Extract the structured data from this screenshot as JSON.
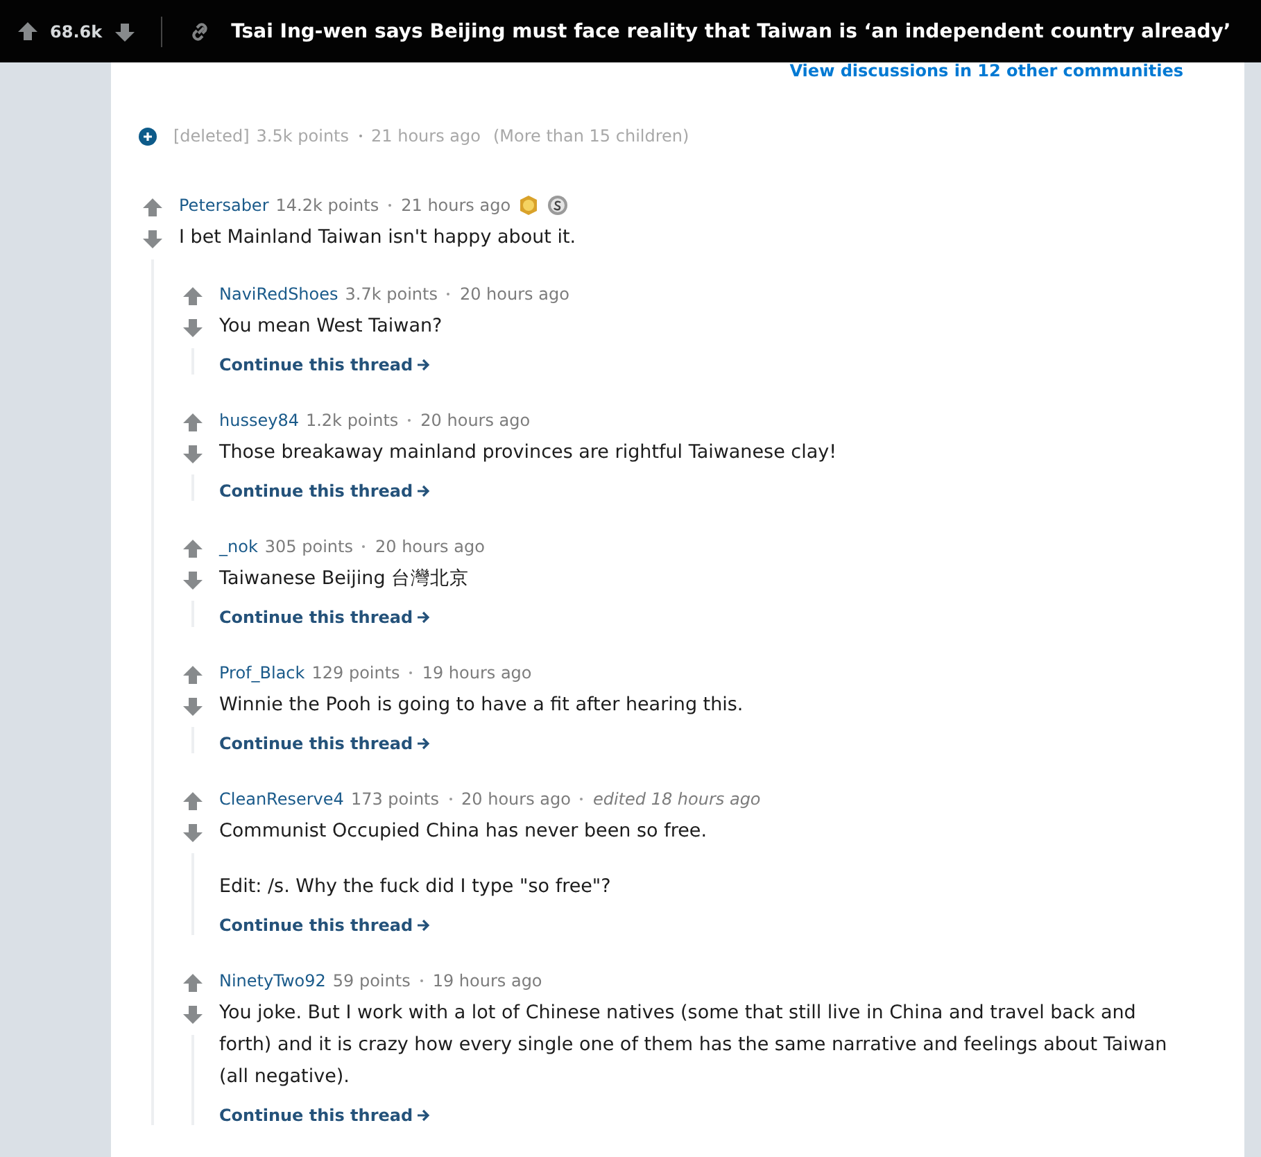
{
  "header": {
    "score": "68.6k",
    "title": "Tsai Ing-wen says Beijing must face reality that Taiwan is ‘an independent country already’"
  },
  "other_discussions": "View discussions in 12 other communities",
  "collapsed_comment": {
    "author": "[deleted]",
    "points": "3.5k points",
    "time": "21 hours ago",
    "children_note": "(More than 15 children)"
  },
  "comment": {
    "author": "Petersaber",
    "points": "14.2k points",
    "time": "21 hours ago",
    "awards": [
      {
        "kind": "gold"
      },
      {
        "kind": "silver"
      }
    ],
    "body": "I bet Mainland Taiwan isn't happy about it.",
    "replies": [
      {
        "author": "NaviRedShoes",
        "points": "3.7k points",
        "time": "20 hours ago",
        "paragraphs": [
          "You mean West Taiwan?"
        ],
        "continue": "Continue this thread"
      },
      {
        "author": "hussey84",
        "points": "1.2k points",
        "time": "20 hours ago",
        "paragraphs": [
          "Those breakaway mainland provinces are rightful Taiwanese clay!"
        ],
        "continue": "Continue this thread"
      },
      {
        "author": "_nok",
        "points": "305 points",
        "time": "20 hours ago",
        "paragraphs": [
          "Taiwanese Beijing 台灣北京"
        ],
        "continue": "Continue this thread"
      },
      {
        "author": "Prof_Black",
        "points": "129 points",
        "time": "19 hours ago",
        "paragraphs": [
          "Winnie the Pooh is going to have a fit after hearing this."
        ],
        "continue": "Continue this thread"
      },
      {
        "author": "CleanReserve4",
        "points": "173 points",
        "time": "20 hours ago",
        "edited": "edited 18 hours ago",
        "paragraphs": [
          "Communist Occupied China has never been so free.",
          "Edit: /s. Why the fuck did I type \"so free\"?"
        ],
        "continue": "Continue this thread"
      },
      {
        "author": "NinetyTwo92",
        "points": "59 points",
        "time": "19 hours ago",
        "paragraphs": [
          "You joke. But I work with a lot of Chinese natives (some that still live in China and travel back and forth) and it is crazy how every single one of them has the same narrative and feelings about Taiwan (all negative)."
        ],
        "continue": "Continue this thread"
      }
    ]
  }
}
